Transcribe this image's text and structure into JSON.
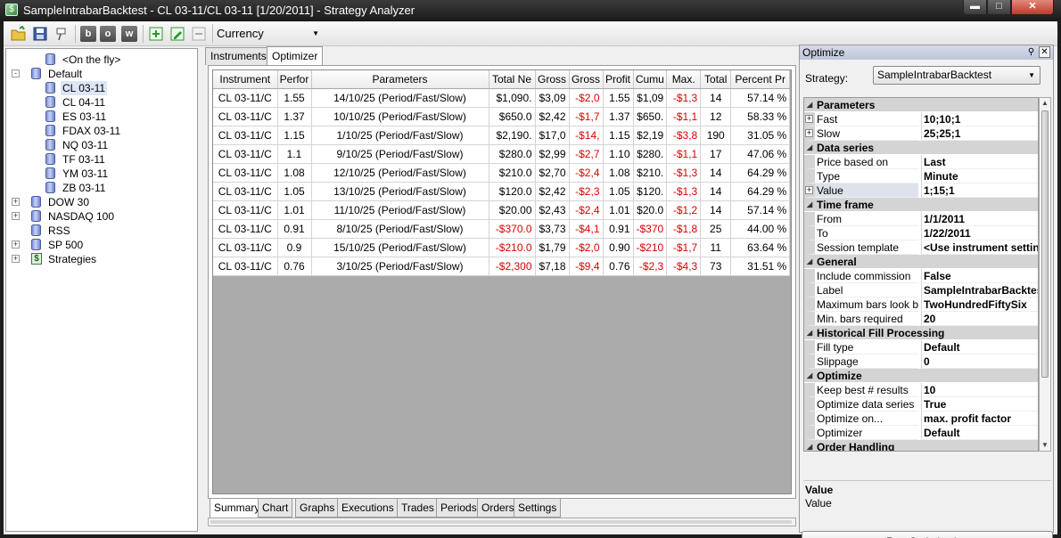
{
  "window": {
    "title": "SampleIntrabarBacktest - CL 03-11/CL 03-11 [1/20/2011] - Strategy Analyzer",
    "min_glyph": "▬",
    "max_glyph": "□",
    "close_glyph": "✕"
  },
  "toolbar": {
    "btn_b": "b",
    "btn_o": "o",
    "btn_w": "w",
    "currency": "Currency"
  },
  "tree": {
    "items": [
      {
        "label": "<On the fly>",
        "icon": "database-icon",
        "level": 1,
        "expander": "none"
      },
      {
        "label": "Default",
        "icon": "database-icon",
        "level": 0,
        "expander": "-"
      },
      {
        "label": "CL 03-11",
        "icon": "database-icon",
        "level": 1,
        "expander": "none",
        "selected": true
      },
      {
        "label": "CL 04-11",
        "icon": "database-icon",
        "level": 1,
        "expander": "none"
      },
      {
        "label": "ES 03-11",
        "icon": "database-icon",
        "level": 1,
        "expander": "none"
      },
      {
        "label": "FDAX 03-11",
        "icon": "database-icon",
        "level": 1,
        "expander": "none"
      },
      {
        "label": "NQ 03-11",
        "icon": "database-icon",
        "level": 1,
        "expander": "none"
      },
      {
        "label": "TF 03-11",
        "icon": "database-icon",
        "level": 1,
        "expander": "none"
      },
      {
        "label": "YM 03-11",
        "icon": "database-icon",
        "level": 1,
        "expander": "none"
      },
      {
        "label": "ZB 03-11",
        "icon": "database-icon",
        "level": 1,
        "expander": "none"
      },
      {
        "label": "DOW 30",
        "icon": "database-icon",
        "level": 0,
        "expander": "+"
      },
      {
        "label": "NASDAQ 100",
        "icon": "database-icon",
        "level": 0,
        "expander": "+"
      },
      {
        "label": "RSS",
        "icon": "database-icon",
        "level": 0,
        "expander": "none"
      },
      {
        "label": "SP 500",
        "icon": "database-icon",
        "level": 0,
        "expander": "+"
      },
      {
        "label": "Strategies",
        "icon": "dollar-icon",
        "level": 0,
        "expander": "+"
      }
    ]
  },
  "top_tabs": [
    {
      "label": "Instruments",
      "active": false
    },
    {
      "label": "Optimizer",
      "active": true
    }
  ],
  "grid": {
    "columns": [
      "Instrument",
      "Perfor",
      "Parameters",
      "Total Ne",
      "Gross",
      "Gross",
      "Profit",
      "Cumu",
      "Max.",
      "Total",
      "Percent Pr"
    ],
    "rows": [
      [
        "CL 03-11/C",
        "1.55",
        "14/10/25 (Period/Fast/Slow)",
        "$1,090.",
        "$3,09",
        "-$2,0",
        "1.55",
        "$1,09",
        "-$1,3",
        "14",
        "57.14 %"
      ],
      [
        "CL 03-11/C",
        "1.37",
        "10/10/25 (Period/Fast/Slow)",
        "$650.0",
        "$2,42",
        "-$1,7",
        "1.37",
        "$650.",
        "-$1,1",
        "12",
        "58.33 %"
      ],
      [
        "CL 03-11/C",
        "1.15",
        "1/10/25 (Period/Fast/Slow)",
        "$2,190.",
        "$17,0",
        "-$14,",
        "1.15",
        "$2,19",
        "-$3,8",
        "190",
        "31.05 %"
      ],
      [
        "CL 03-11/C",
        "1.1",
        "9/10/25 (Period/Fast/Slow)",
        "$280.0",
        "$2,99",
        "-$2,7",
        "1.10",
        "$280.",
        "-$1,1",
        "17",
        "47.06 %"
      ],
      [
        "CL 03-11/C",
        "1.08",
        "12/10/25 (Period/Fast/Slow)",
        "$210.0",
        "$2,70",
        "-$2,4",
        "1.08",
        "$210.",
        "-$1,3",
        "14",
        "64.29 %"
      ],
      [
        "CL 03-11/C",
        "1.05",
        "13/10/25 (Period/Fast/Slow)",
        "$120.0",
        "$2,42",
        "-$2,3",
        "1.05",
        "$120.",
        "-$1,3",
        "14",
        "64.29 %"
      ],
      [
        "CL 03-11/C",
        "1.01",
        "11/10/25 (Period/Fast/Slow)",
        "$20.00",
        "$2,43",
        "-$2,4",
        "1.01",
        "$20.0",
        "-$1,2",
        "14",
        "57.14 %"
      ],
      [
        "CL 03-11/C",
        "0.91",
        "8/10/25 (Period/Fast/Slow)",
        "-$370.0",
        "$3,73",
        "-$4,1",
        "0.91",
        "-$370",
        "-$1,8",
        "25",
        "44.00 %"
      ],
      [
        "CL 03-11/C",
        "0.9",
        "15/10/25 (Period/Fast/Slow)",
        "-$210.0",
        "$1,79",
        "-$2,0",
        "0.90",
        "-$210",
        "-$1,7",
        "11",
        "63.64 %"
      ],
      [
        "CL 03-11/C",
        "0.76",
        "3/10/25 (Period/Fast/Slow)",
        "-$2,300",
        "$7,18",
        "-$9,4",
        "0.76",
        "-$2,3",
        "-$4,3",
        "73",
        "31.51 %"
      ]
    ]
  },
  "bottom_tabs": [
    {
      "label": "Summary",
      "active": true
    },
    {
      "label": "Chart",
      "active": false
    },
    {
      "label": "Graphs",
      "active": false
    },
    {
      "label": "Executions",
      "active": false
    },
    {
      "label": "Trades",
      "active": false
    },
    {
      "label": "Periods",
      "active": false
    },
    {
      "label": "Orders",
      "active": false
    },
    {
      "label": "Settings",
      "active": false
    }
  ],
  "optimize": {
    "header": "Optimize",
    "strategy_label": "Strategy:",
    "strategy_value": "SampleIntrabarBacktest",
    "properties": [
      {
        "kind": "cat",
        "label": "Parameters"
      },
      {
        "kind": "prop",
        "name": "Fast",
        "value": "10;10;1",
        "expandable": true
      },
      {
        "kind": "prop",
        "name": "Slow",
        "value": "25;25;1",
        "expandable": true
      },
      {
        "kind": "cat",
        "label": "Data series"
      },
      {
        "kind": "prop",
        "name": "Price based on",
        "value": "Last"
      },
      {
        "kind": "prop",
        "name": "Type",
        "value": "Minute"
      },
      {
        "kind": "prop",
        "name": "Value",
        "value": "1;15;1",
        "expandable": true,
        "highlight": true
      },
      {
        "kind": "cat",
        "label": "Time frame"
      },
      {
        "kind": "prop",
        "name": "From",
        "value": "1/1/2011"
      },
      {
        "kind": "prop",
        "name": "To",
        "value": "1/22/2011"
      },
      {
        "kind": "prop",
        "name": "Session template",
        "value": "<Use instrument settings>"
      },
      {
        "kind": "cat",
        "label": "General"
      },
      {
        "kind": "prop",
        "name": "Include commission",
        "value": "False"
      },
      {
        "kind": "prop",
        "name": "Label",
        "value": "SampleIntrabarBacktest"
      },
      {
        "kind": "prop",
        "name": "Maximum bars look back",
        "value": "TwoHundredFiftySix"
      },
      {
        "kind": "prop",
        "name": "Min. bars required",
        "value": "20"
      },
      {
        "kind": "cat",
        "label": "Historical Fill Processing"
      },
      {
        "kind": "prop",
        "name": "Fill type",
        "value": "Default"
      },
      {
        "kind": "prop",
        "name": "Slippage",
        "value": "0"
      },
      {
        "kind": "cat",
        "label": "Optimize"
      },
      {
        "kind": "prop",
        "name": "Keep best # results",
        "value": "10"
      },
      {
        "kind": "prop",
        "name": "Optimize data series",
        "value": "True"
      },
      {
        "kind": "prop",
        "name": "Optimize on...",
        "value": "max. profit factor"
      },
      {
        "kind": "prop",
        "name": "Optimizer",
        "value": "Default"
      },
      {
        "kind": "cat",
        "label": "Order Handling"
      }
    ],
    "description_title": "Value",
    "description_text": "Value",
    "run_button": "Run Optimization"
  }
}
